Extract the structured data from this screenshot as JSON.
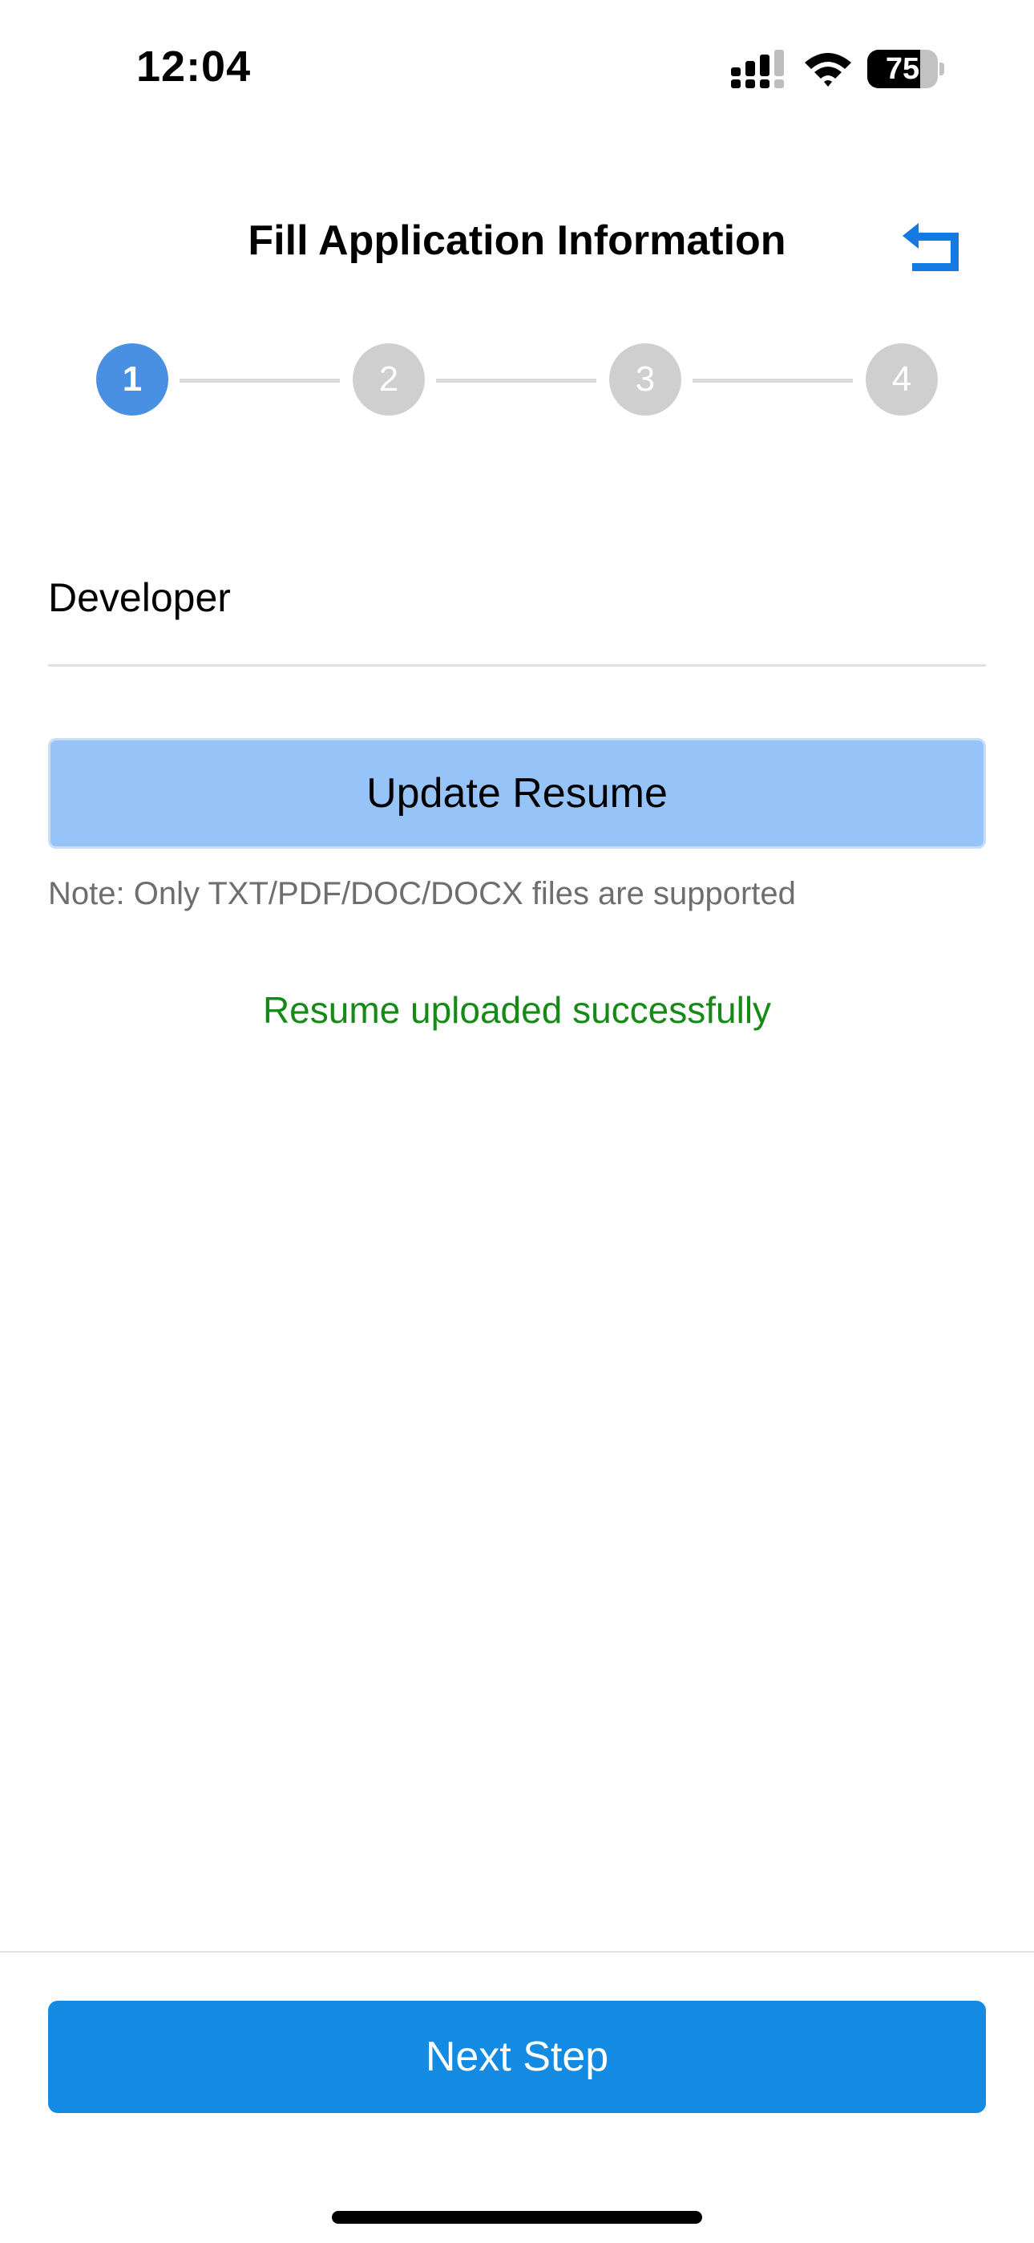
{
  "status_bar": {
    "time": "12:04",
    "signal_icon": "cellular-signal-icon",
    "wifi_icon": "wifi-icon",
    "battery_level": 75,
    "battery_text": "75"
  },
  "header": {
    "title": "Fill Application Information",
    "back_icon": "back-arrow-icon"
  },
  "stepper": {
    "current_step": 1,
    "steps": [
      "1",
      "2",
      "3",
      "4"
    ]
  },
  "form": {
    "position_value": "Developer",
    "update_resume_label": "Update Resume",
    "note": "Note: Only TXT/PDF/DOC/DOCX files are supported",
    "status_message": "Resume uploaded successfully"
  },
  "footer": {
    "next_label": "Next Step"
  },
  "colors": {
    "accent": "#138be3",
    "active_step": "#4a90e2",
    "inactive_step": "#cfcfcf",
    "upload_button": "#96c4f8",
    "success": "#168a16"
  }
}
